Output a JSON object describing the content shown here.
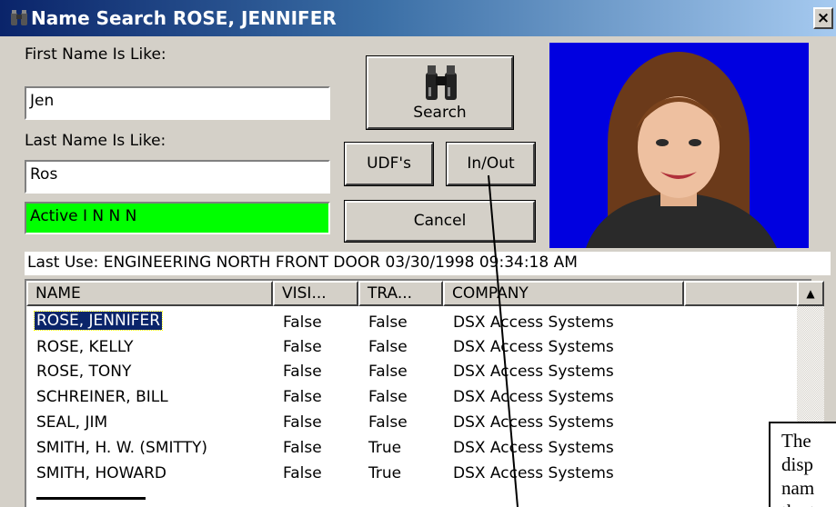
{
  "window": {
    "title": "Name Search  ROSE, JENNIFER",
    "close_label": "×"
  },
  "form": {
    "first_name_label": "First Name Is Like:",
    "first_name_value": "Jen",
    "last_name_label": "Last Name Is Like:",
    "last_name_value": "Ros",
    "status_text": "Active    I  N  N  N",
    "status_color": "#00ff00"
  },
  "buttons": {
    "search": "Search",
    "udfs": "UDF's",
    "in_out": "In/Out",
    "cancel": "Cancel"
  },
  "last_use": "Last Use: ENGINEERING NORTH FRONT DOOR  03/30/1998 09:34:18 AM",
  "table": {
    "headers": [
      "NAME",
      "VISI...",
      "TRA...",
      "COMPANY",
      ""
    ],
    "rows": [
      {
        "name": "ROSE, JENNIFER",
        "visitor": "False",
        "trace": "False",
        "company": "DSX Access Systems",
        "selected": true
      },
      {
        "name": "ROSE, KELLY",
        "visitor": "False",
        "trace": "False",
        "company": "DSX Access Systems"
      },
      {
        "name": "ROSE, TONY",
        "visitor": "False",
        "trace": "False",
        "company": "DSX Access Systems"
      },
      {
        "name": "SCHREINER, BILL",
        "visitor": "False",
        "trace": "False",
        "company": "DSX Access Systems"
      },
      {
        "name": "SEAL, JIM",
        "visitor": "False",
        "trace": "False",
        "company": "DSX Access Systems"
      },
      {
        "name": "SMITH, H. W. (SMITTY)",
        "visitor": "False",
        "trace": "True",
        "company": "DSX Access Systems"
      },
      {
        "name": "SMITH, HOWARD",
        "visitor": "False",
        "trace": "True",
        "company": "DSX Access Systems"
      }
    ]
  },
  "callout": {
    "lines": [
      "The",
      "disp",
      "nam",
      "the t"
    ]
  },
  "icons": {
    "title": "binoculars-icon",
    "search": "binoculars-icon",
    "scroll_up": "triangle-up-icon"
  },
  "colors": {
    "title_bar": "#0a246a",
    "photo_background": "#0000e0",
    "selection": "#0a246a"
  }
}
